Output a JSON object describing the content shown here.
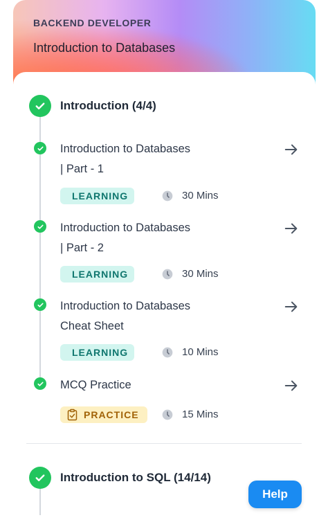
{
  "header": {
    "overline": "BACKEND DEVELOPER",
    "title": "Introduction to Databases"
  },
  "sections": [
    {
      "title": "Introduction (4/4)",
      "completed": true,
      "items": [
        {
          "title_line1": "Introduction to Databases",
          "title_line2": "| Part - 1",
          "type": "LEARNING",
          "duration": "30 Mins",
          "completed": true
        },
        {
          "title_line1": "Introduction to Databases",
          "title_line2": "| Part - 2",
          "type": "LEARNING",
          "duration": "30 Mins",
          "completed": true
        },
        {
          "title_line1": "Introduction to Databases",
          "title_line2": "Cheat Sheet",
          "type": "LEARNING",
          "duration": "10 Mins",
          "completed": true
        },
        {
          "title_line1": "MCQ Practice",
          "title_line2": "",
          "type": "PRACTICE",
          "duration": "15 Mins",
          "completed": true
        }
      ]
    },
    {
      "title": "Introduction to SQL (14/14)",
      "completed": true
    }
  ],
  "help_button": "Help",
  "icons": {
    "section_check": "check-circle-icon",
    "item_check": "check-circle-icon",
    "open": "arrow-right-icon",
    "learning": "book-open-icon",
    "practice": "clipboard-check-icon",
    "duration": "clock-icon"
  },
  "colors": {
    "success": "#22c55e",
    "learning_bg": "#d2f5ef",
    "learning_text": "#0f766e",
    "practice_bg": "#fdf0c2",
    "practice_text": "#a16207",
    "help_button": "#1a8bf2"
  }
}
